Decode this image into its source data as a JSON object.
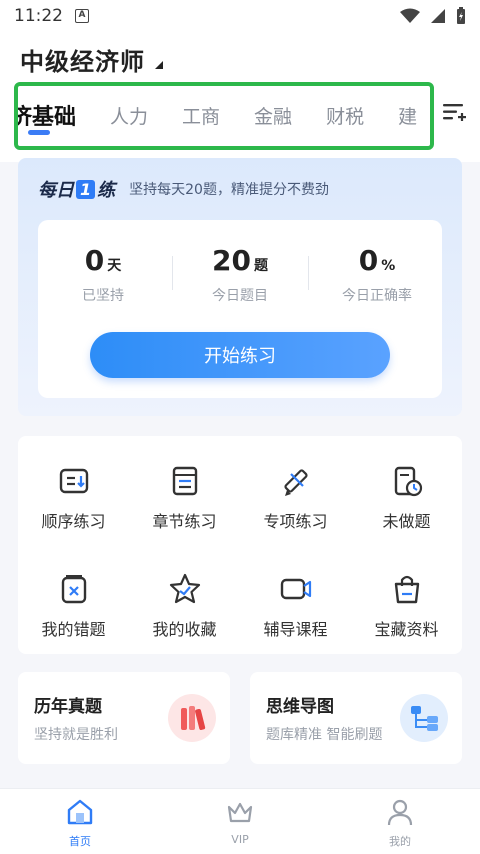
{
  "status_bar": {
    "time": "11:22",
    "notif_letter": "A"
  },
  "header": {
    "title": "中级经济师",
    "tabs": [
      "济基础",
      "人力",
      "工商",
      "金融",
      "财税",
      "建"
    ]
  },
  "daily": {
    "logo_left": "每日",
    "logo_num": "1",
    "logo_right": "练",
    "slogan": "坚持每天20题，精准提分不费劲",
    "stats": [
      {
        "value": "0",
        "unit": "天",
        "label": "已坚持"
      },
      {
        "value": "20",
        "unit": "题",
        "label": "今日题目"
      },
      {
        "value": "0",
        "unit": "%",
        "label": "今日正确率"
      }
    ],
    "start_label": "开始练习"
  },
  "grid": [
    {
      "label": "顺序练习",
      "icon": "list-icon"
    },
    {
      "label": "章节练习",
      "icon": "book-icon"
    },
    {
      "label": "专项练习",
      "icon": "pencil-ruler-icon"
    },
    {
      "label": "未做题",
      "icon": "clock-doc-icon"
    },
    {
      "label": "我的错题",
      "icon": "wrong-doc-icon"
    },
    {
      "label": "我的收藏",
      "icon": "star-icon"
    },
    {
      "label": "辅导课程",
      "icon": "video-icon"
    },
    {
      "label": "宝藏资料",
      "icon": "bag-icon"
    }
  ],
  "cards": [
    {
      "title": "历年真题",
      "subtitle": "坚持就是胜利"
    },
    {
      "title": "思维导图",
      "subtitle": "题库精准 智能刷题"
    }
  ],
  "nav": [
    {
      "label": "首页"
    },
    {
      "label": "VIP"
    },
    {
      "label": "我的"
    }
  ],
  "colors": {
    "accent": "#2f7cf6",
    "highlight_box": "#2db84b"
  }
}
